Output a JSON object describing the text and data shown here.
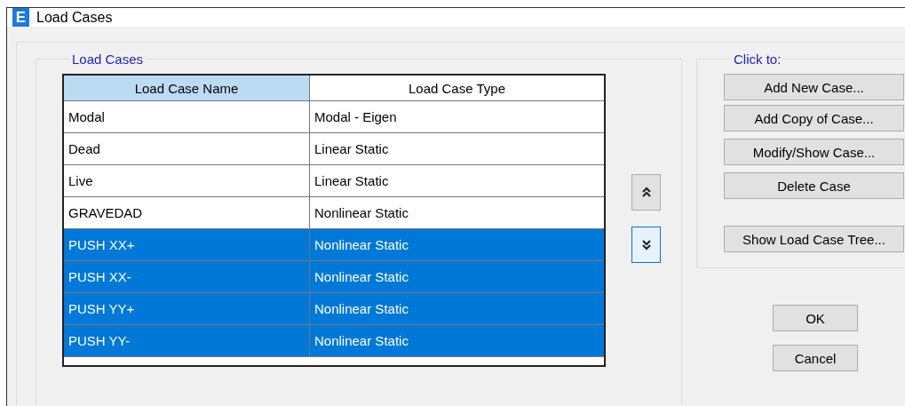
{
  "window": {
    "icon_text": "E",
    "title": "Load Cases"
  },
  "load_cases": {
    "legend": "Load Cases",
    "columns": [
      {
        "label": "Load Case Name",
        "selected": true
      },
      {
        "label": "Load Case Type",
        "selected": false
      }
    ],
    "rows": [
      {
        "name": "Modal",
        "type": "Modal - Eigen",
        "selected": false
      },
      {
        "name": "Dead",
        "type": "Linear Static",
        "selected": false
      },
      {
        "name": "Live",
        "type": "Linear Static",
        "selected": false
      },
      {
        "name": "GRAVEDAD",
        "type": "Nonlinear Static",
        "selected": false
      },
      {
        "name": "PUSH XX+",
        "type": "Nonlinear Static",
        "selected": true
      },
      {
        "name": "PUSH XX-",
        "type": "Nonlinear Static",
        "selected": true
      },
      {
        "name": "PUSH YY+",
        "type": "Nonlinear Static",
        "selected": true
      },
      {
        "name": "PUSH YY-",
        "type": "Nonlinear Static",
        "selected": true
      }
    ]
  },
  "move_buttons": [
    {
      "kind": "up",
      "focused": false
    },
    {
      "kind": "down",
      "focused": true
    }
  ],
  "click_to": {
    "legend": "Click to:",
    "buttons": [
      "Add New Case...",
      "Add Copy of Case...",
      "Modify/Show Case...",
      "Delete Case",
      "Show Load Case Tree..."
    ]
  },
  "dialog_buttons": [
    "OK",
    "Cancel"
  ]
}
